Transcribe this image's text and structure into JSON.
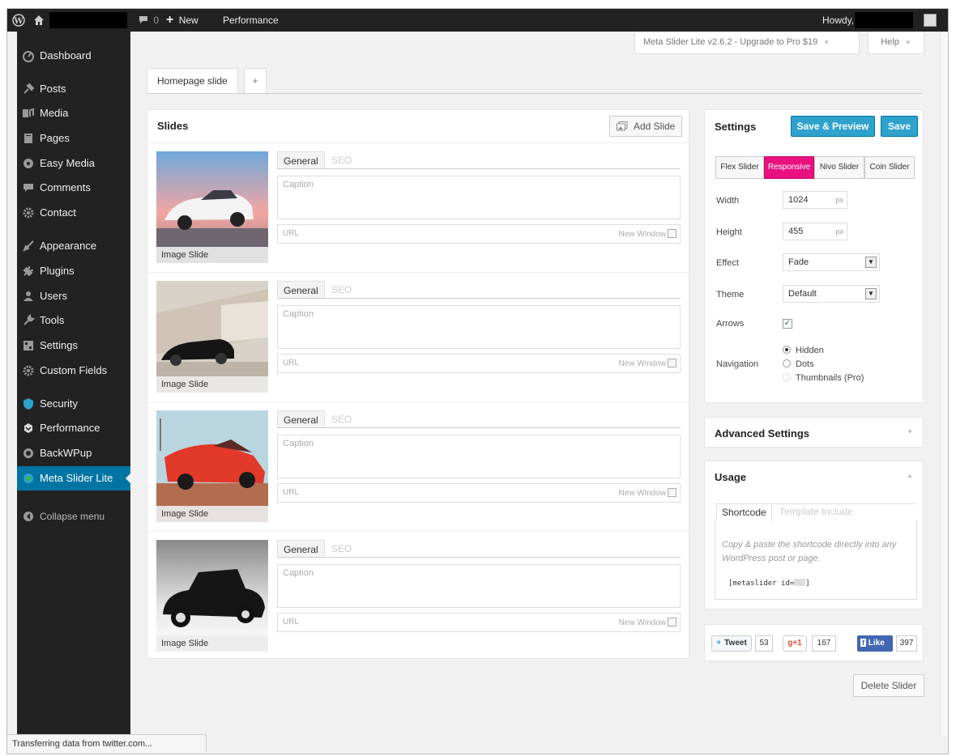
{
  "admin_bar": {
    "comments_count": "0",
    "new_label": "New",
    "performance_label": "Performance",
    "howdy": "Howdy,"
  },
  "sidebar": {
    "items": [
      {
        "label": "Dashboard",
        "icon": "dashboard-icon"
      },
      {
        "label": "Posts",
        "icon": "pin-icon"
      },
      {
        "label": "Media",
        "icon": "media-icon"
      },
      {
        "label": "Pages",
        "icon": "page-icon"
      },
      {
        "label": "Easy Media",
        "icon": "easy-media-icon"
      },
      {
        "label": "Comments",
        "icon": "comment-icon"
      },
      {
        "label": "Contact",
        "icon": "gear-icon"
      },
      {
        "label": "Appearance",
        "icon": "brush-icon"
      },
      {
        "label": "Plugins",
        "icon": "plug-icon"
      },
      {
        "label": "Users",
        "icon": "user-icon"
      },
      {
        "label": "Tools",
        "icon": "wrench-icon"
      },
      {
        "label": "Settings",
        "icon": "settings-icon"
      },
      {
        "label": "Custom Fields",
        "icon": "gear-icon"
      },
      {
        "label": "Security",
        "icon": "shield-icon"
      },
      {
        "label": "Performance",
        "icon": "performance-icon"
      },
      {
        "label": "BackWPup",
        "icon": "backup-icon"
      },
      {
        "label": "Meta Slider Lite",
        "icon": "slider-icon"
      }
    ],
    "collapse_label": "Collapse menu",
    "active_color": "#0074a2"
  },
  "screen_tabs": {
    "upgrade_label": "Meta Slider Lite v2.6.2 - Upgrade to Pro $19",
    "help_label": "Help"
  },
  "slider_tabs": {
    "current": "Homepage slide",
    "add": "+"
  },
  "slides_panel": {
    "title": "Slides",
    "add_slide_label": "Add Slide",
    "slides": [
      {
        "type_label": "Image Slide",
        "tab_general": "General",
        "tab_seo": "SEO",
        "caption_placeholder": "Caption",
        "url_placeholder": "URL",
        "new_window_label": "New Window"
      },
      {
        "type_label": "Image Slide",
        "tab_general": "General",
        "tab_seo": "SEO",
        "caption_placeholder": "Caption",
        "url_placeholder": "URL",
        "new_window_label": "New Window"
      },
      {
        "type_label": "Image Slide",
        "tab_general": "General",
        "tab_seo": "SEO",
        "caption_placeholder": "Caption",
        "url_placeholder": "URL",
        "new_window_label": "New Window"
      },
      {
        "type_label": "Image Slide",
        "tab_general": "General",
        "tab_seo": "SEO",
        "caption_placeholder": "Caption",
        "url_placeholder": "URL",
        "new_window_label": "New Window"
      }
    ]
  },
  "settings_panel": {
    "title": "Settings",
    "save_preview_label": "Save & Preview",
    "save_label": "Save",
    "slider_types": [
      "Flex Slider",
      "Responsive",
      "Nivo Slider",
      "Coin Slider"
    ],
    "selected_type": "Responsive",
    "selected_color": "#e8117f",
    "width_label": "Width",
    "width_value": "1024",
    "height_label": "Height",
    "height_value": "455",
    "unit": "px",
    "effect_label": "Effect",
    "effect_value": "Fade",
    "theme_label": "Theme",
    "theme_value": "Default",
    "arrows_label": "Arrows",
    "arrows_checked": true,
    "navigation_label": "Navigation",
    "navigation_options": [
      "Hidden",
      "Dots",
      "Thumbnails (Pro)"
    ],
    "navigation_selected": "Hidden"
  },
  "advanced_panel": {
    "title": "Advanced Settings"
  },
  "usage_panel": {
    "title": "Usage",
    "tab_shortcode": "Shortcode",
    "tab_template": "Template Include",
    "instructions": "Copy & paste the shortcode directly into any WordPress post or page.",
    "shortcode": "[metaslider id=",
    "shortcode_end": "]"
  },
  "social": {
    "tweet_label": "Tweet",
    "tweet_count": "53",
    "gplus_label": "+1",
    "gplus_count": "167",
    "like_label": "Like",
    "like_count": "397"
  },
  "delete_label": "Delete Slider",
  "status_text": "Transferring data from twitter.com...",
  "accent_color": "#2ea2cc"
}
